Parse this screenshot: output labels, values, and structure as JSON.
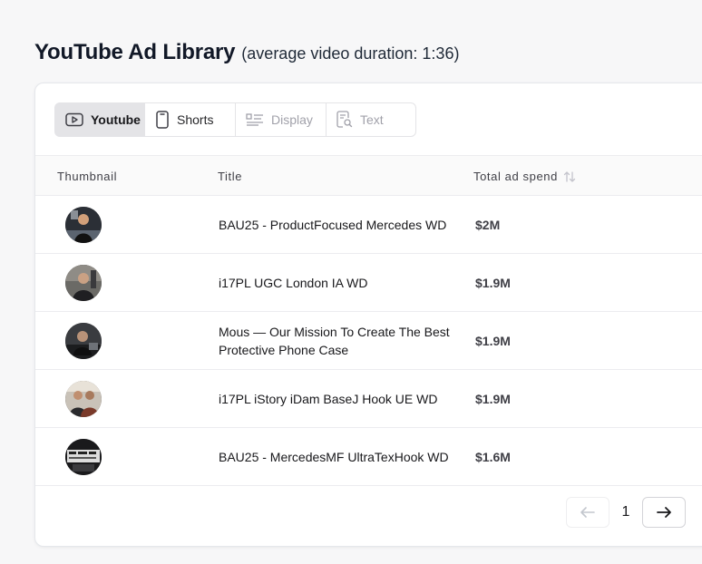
{
  "page": {
    "title": "YouTube Ad Library",
    "subtitle": "(average video duration: 1:36)"
  },
  "tabs": [
    {
      "label": "Youtube",
      "icon": "play-icon",
      "state": "active"
    },
    {
      "label": "Shorts",
      "icon": "phone-icon",
      "state": "normal"
    },
    {
      "label": "Display",
      "icon": "display-icon",
      "state": "disabled"
    },
    {
      "label": "Text",
      "icon": "text-search-icon",
      "state": "disabled"
    }
  ],
  "table": {
    "columns": [
      "Thumbnail",
      "Title",
      "Total ad spend"
    ],
    "sort_icon": "sort-arrows-icon",
    "rows": [
      {
        "title": "BAU25 - ProductFocused Mercedes WD",
        "spend": "$2M"
      },
      {
        "title": "i17PL UGC London IA WD",
        "spend": "$1.9M"
      },
      {
        "title": "Mous — Our Mission To Create The Best Protective Phone Case",
        "spend": "$1.9M"
      },
      {
        "title": "i17PL iStory iDam BaseJ Hook UE WD",
        "spend": "$1.9M"
      },
      {
        "title": "BAU25 - MercedesMF UltraTexHook WD",
        "spend": "$1.6M"
      }
    ]
  },
  "pagination": {
    "current_page": "1",
    "prev_icon": "arrow-left-icon",
    "next_icon": "arrow-right-icon"
  },
  "colors": {
    "active_tab_bg": "#e4e4e7",
    "border": "#e4e4e7",
    "text": "#18181b",
    "muted": "#a1a1aa"
  }
}
